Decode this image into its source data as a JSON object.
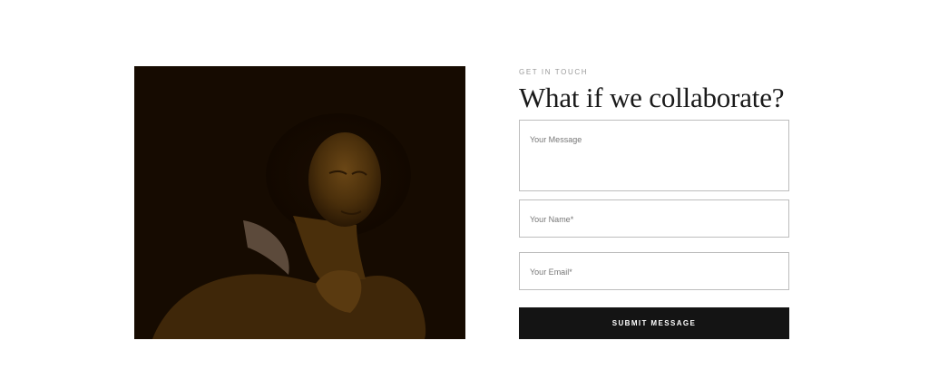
{
  "contact": {
    "eyebrow": "GET IN TOUCH",
    "heading": "What if we collaborate?",
    "form": {
      "message_placeholder": "Your Message",
      "name_placeholder": "Your Name*",
      "email_placeholder": "Your Email*",
      "submit_label": "SUBMIT MESSAGE"
    }
  },
  "colors": {
    "button_bg": "#141414",
    "heading": "#1a1a1a",
    "field_border": "#bdbdbd",
    "photo_tone": "#241503"
  }
}
